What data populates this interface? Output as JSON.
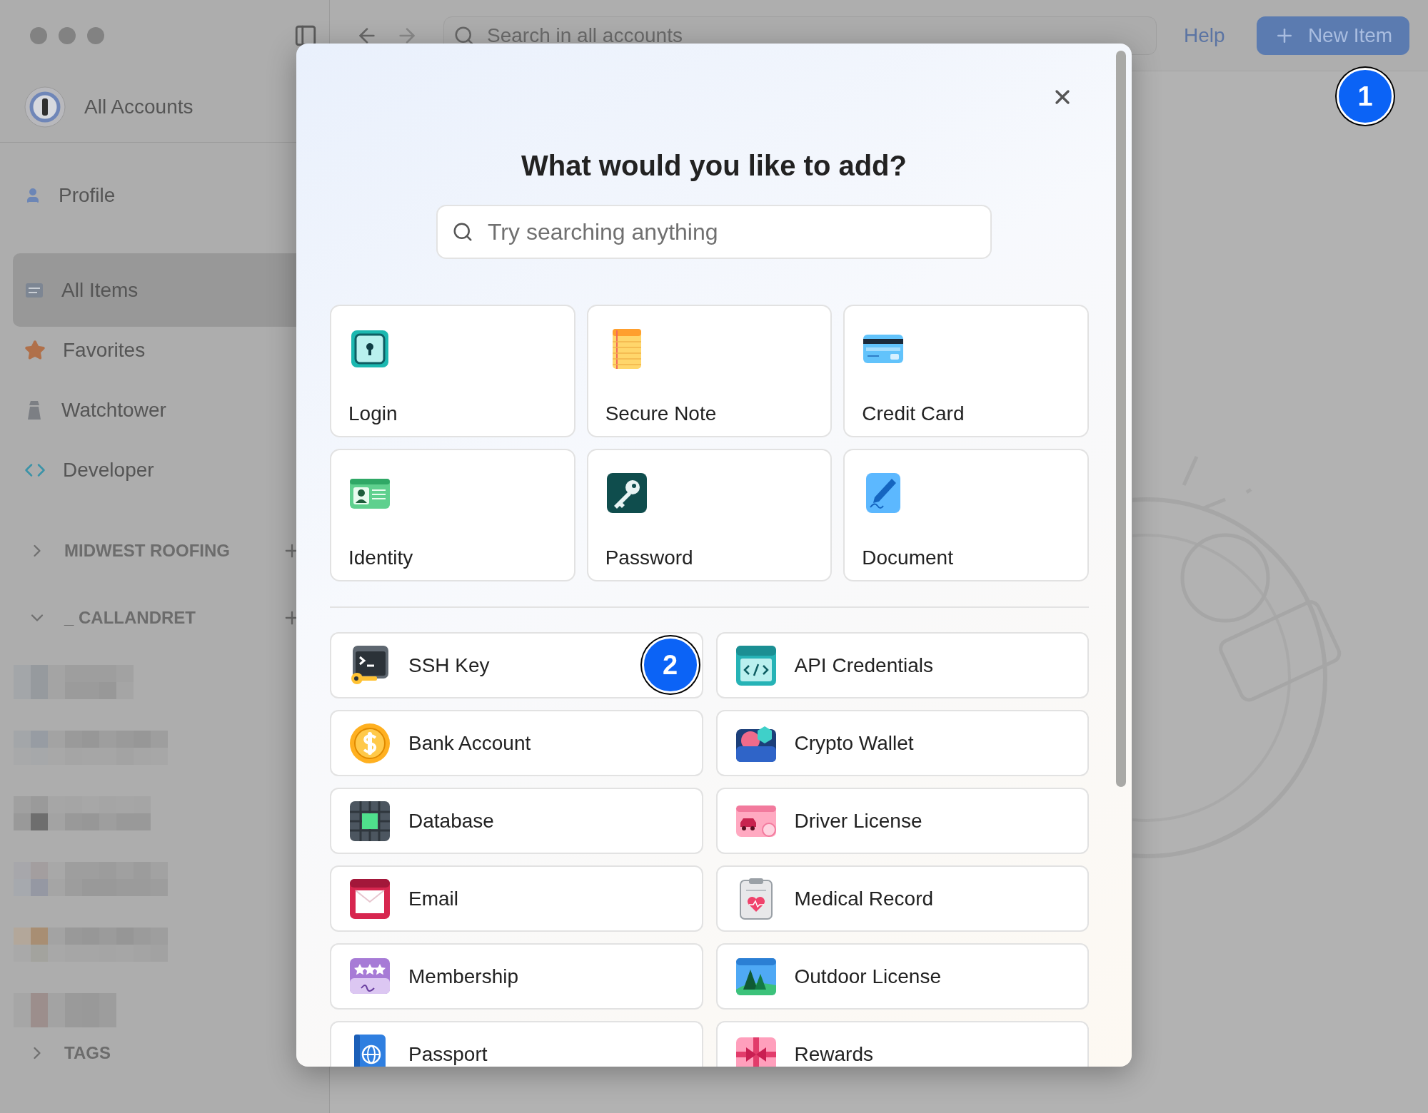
{
  "sidebar": {
    "account": {
      "label": "All Accounts"
    },
    "profile": {
      "label": "Profile"
    },
    "items": [
      {
        "label": "All Items",
        "selected": true
      },
      {
        "label": "Favorites",
        "selected": false
      },
      {
        "label": "Watchtower",
        "selected": false
      },
      {
        "label": "Developer",
        "selected": false
      }
    ],
    "sections": [
      {
        "label": "MIDWEST ROOFING",
        "expanded": false
      },
      {
        "label": "_ CALLANDRET",
        "expanded": true
      }
    ],
    "tags": {
      "label": "TAGS",
      "expanded": false
    }
  },
  "toolbar": {
    "search": {
      "placeholder": "Search in all accounts"
    },
    "help": "Help",
    "new_item": "New Item",
    "step_badge": "1"
  },
  "modal": {
    "title": "What would you like to add?",
    "search": {
      "placeholder": "Try searching anything"
    },
    "featured": [
      {
        "label": "Login"
      },
      {
        "label": "Secure Note"
      },
      {
        "label": "Credit Card"
      },
      {
        "label": "Identity"
      },
      {
        "label": "Password"
      },
      {
        "label": "Document"
      }
    ],
    "categories": [
      {
        "label": "SSH Key",
        "step_badge": "2"
      },
      {
        "label": "API Credentials"
      },
      {
        "label": "Bank Account"
      },
      {
        "label": "Crypto Wallet"
      },
      {
        "label": "Database"
      },
      {
        "label": "Driver License"
      },
      {
        "label": "Email"
      },
      {
        "label": "Medical Record"
      },
      {
        "label": "Membership"
      },
      {
        "label": "Outdoor License"
      },
      {
        "label": "Passport"
      },
      {
        "label": "Rewards"
      }
    ]
  }
}
